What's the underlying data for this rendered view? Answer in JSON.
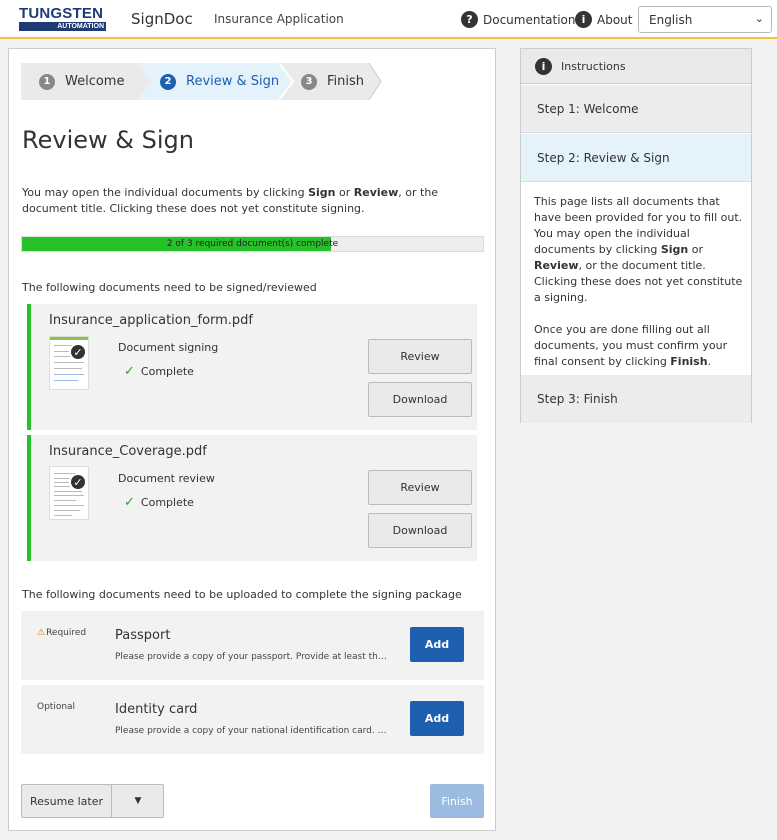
{
  "header": {
    "logo_text": "TUNGSTEN",
    "logo_sub": "AUTOMATION",
    "app_name": "SignDoc",
    "app_subtitle": "Insurance Application",
    "documentation_label": "Documentation",
    "about_label": "About",
    "language": "English"
  },
  "stepper": {
    "steps": [
      {
        "num": "1",
        "label": "Welcome"
      },
      {
        "num": "2",
        "label": "Review & Sign"
      },
      {
        "num": "3",
        "label": "Finish"
      }
    ]
  },
  "main": {
    "title": "Review & Sign",
    "intro_pre": "You may open the individual documents by clicking ",
    "intro_sign": "Sign",
    "intro_or": " or ",
    "intro_review": "Review",
    "intro_post": ", or the document title. Clicking these does not yet constitute signing.",
    "progress_text": "2 of 3 required document(s) complete",
    "progress_fraction": 0.67,
    "sign_section_label": "The following documents need to be signed/reviewed",
    "documents": [
      {
        "title": "Insurance_application_form.pdf",
        "action": "Document signing",
        "status": "Complete",
        "review_label": "Review",
        "download_label": "Download"
      },
      {
        "title": "Insurance_Coverage.pdf",
        "action": "Document review",
        "status": "Complete",
        "review_label": "Review",
        "download_label": "Download"
      }
    ],
    "upload_section_label": "The following documents need to be uploaded to complete the signing package",
    "uploads": [
      {
        "requirement": "Required",
        "title": "Passport",
        "description": "Please provide a copy of your passport. Provide at least the i...",
        "add_label": "Add"
      },
      {
        "requirement": "Optional",
        "title": "Identity card",
        "description": "Please provide a copy of your national identification card. Th...",
        "add_label": "Add"
      }
    ],
    "resume_label": "Resume later",
    "finish_label": "Finish"
  },
  "instructions": {
    "title": "Instructions",
    "step1": "Step 1: Welcome",
    "step2": "Step 2: Review & Sign",
    "step3": "Step 3: Finish",
    "p1_pre": "This page lists all documents that have been provided for you to fill out. You may open the individual documents by clicking ",
    "p1_sign": "Sign",
    "p1_or": " or ",
    "p1_review": "Review",
    "p1_post": ", or the document title. Clicking these does not yet constitute a signing.",
    "p2_pre": "Once you are done filling out all documents, you must confirm your final consent by clicking ",
    "p2_finish": "Finish",
    "p2_post": "."
  }
}
